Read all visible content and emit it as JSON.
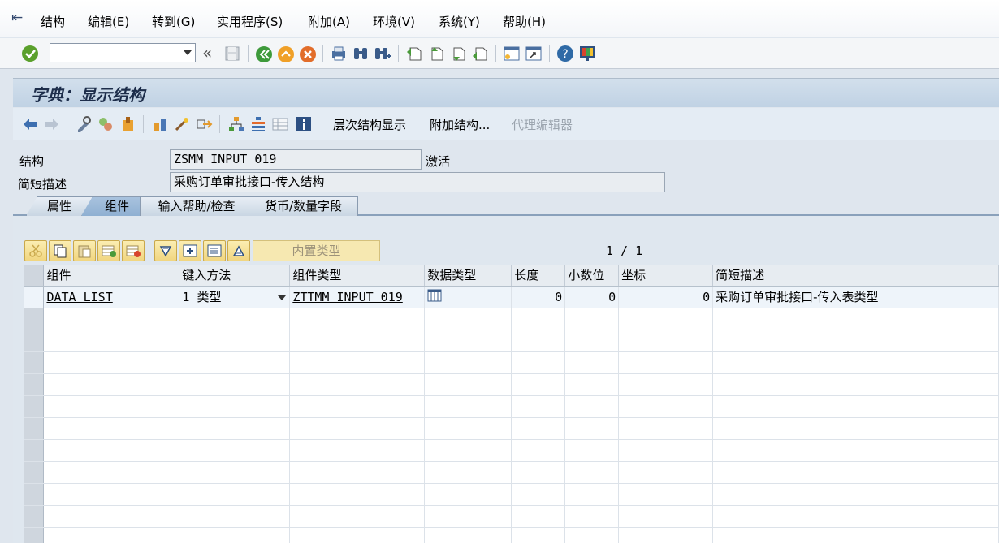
{
  "menubar": {
    "items": [
      "结构",
      "编辑(E)",
      "转到(G)",
      "实用程序(S)",
      "附加(A)",
      "环境(V)",
      "系统(Y)",
      "帮助(H)"
    ]
  },
  "toolbar": {
    "command_value": "",
    "icons": [
      "enter-icon",
      "back-icon",
      "save-icon",
      "back-green-icon",
      "exit-icon",
      "cancel-icon",
      "print-icon",
      "find-icon",
      "find-next-icon",
      "first-page-icon",
      "prev-page-icon",
      "next-page-icon",
      "last-page-icon",
      "new-session-icon",
      "shortcut-icon",
      "help-icon",
      "customize-layout-icon"
    ]
  },
  "title": "字典：显示结构",
  "app_toolbar": {
    "hierarchy_label": "层次结构显示",
    "append_label": "附加结构...",
    "proxy_label": "代理编辑器"
  },
  "header": {
    "structure_label": "结构",
    "structure_value": "ZSMM_INPUT_019",
    "status": "激活",
    "short_desc_label": "简短描述",
    "short_desc_value": "采购订单审批接口-传入结构"
  },
  "tabs": [
    "属性",
    "组件",
    "输入帮助/检查",
    "货币/数量字段"
  ],
  "active_tab": 1,
  "grid_toolbar": {
    "builtin_type_label": "内置类型",
    "page_info": "1 / 1"
  },
  "table": {
    "columns": [
      "组件",
      "键入方法",
      "组件类型",
      "数据类型",
      "长度",
      "小数位",
      "坐标",
      "简短描述"
    ],
    "rows": [
      {
        "component": "DATA_LIST",
        "typing": "1 类型",
        "comp_type": "ZTTMM_INPUT_019",
        "data_type": "table-type-icon",
        "length": "0",
        "decimals": "0",
        "coord": "0",
        "desc": "采购订单审批接口-传入表类型"
      }
    ]
  },
  "colors": {
    "accent": "#1d2d4a",
    "title_bg": "#c0d2e4",
    "grid_header": "#e7ecf1"
  }
}
